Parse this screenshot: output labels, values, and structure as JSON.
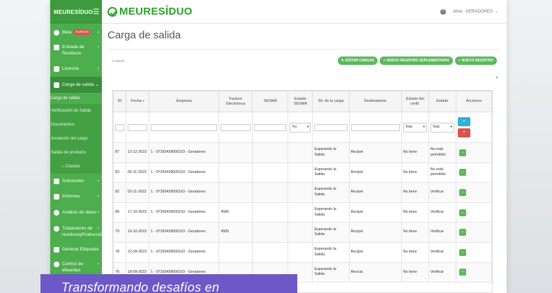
{
  "sidebar": {
    "brand": "MEURESÍDUO",
    "items": [
      {
        "label": "Beta",
        "badge": "NUEVOS"
      },
      {
        "label": "Entrada de Residuos"
      },
      {
        "label": "Licencia"
      },
      {
        "label": "Carga de salida"
      },
      {
        "label": "Solicitudes"
      },
      {
        "label": "Informes"
      },
      {
        "label": "Análisis de datos"
      },
      {
        "label": "Tratamiento de residuosyProducción"
      },
      {
        "label": "Generar Etiquetas"
      },
      {
        "label": "Control de efluentes"
      }
    ],
    "submenu": [
      "Carga de salida",
      "Verificación de Salida",
      "Documentos",
      "Anulación del cargo",
      "Salida de producto",
      "Checkis"
    ]
  },
  "topbar": {
    "logo": "MEURESÍDUO",
    "user": "Aline - GERADORES"
  },
  "page": {
    "title": "Carga de salida",
    "listado": "Listado"
  },
  "buttons": {
    "edit": "EDITAR CARGAS",
    "new_supplementary": "NUEVO REGISTRO SUPLEMENTARIO",
    "new_record": "NUEVO REGISTRO"
  },
  "table": {
    "headers": [
      "ID",
      "Fecha",
      "Empresa",
      "Facture Electrónica",
      "SESMA",
      "Estado SESMA",
      "Sit. de la carga",
      "Destinatarios",
      "Estado del certif.",
      "Estado",
      "Acciones"
    ],
    "filters": {
      "sesma_status": "Toi",
      "cert": "Todc",
      "estado": "Todc"
    },
    "rows": [
      {
        "id": "87",
        "fecha": "12-12-2023",
        "empresa": "1 - 97393439000163 - Geradores",
        "factura": "",
        "sit": "Esperando la Salida",
        "dest": "Recipel",
        "cert": "No tiene",
        "estado": "No está permitido"
      },
      {
        "id": "83",
        "fecha": "06-11-2023",
        "empresa": "1 - 97393439000163 - Geradores",
        "factura": "",
        "sit": "Esperando la Salida",
        "dest": "Recipel",
        "cert": "No tiene",
        "estado": "No está permitido"
      },
      {
        "id": "82",
        "fecha": "03-11-2023",
        "empresa": "1 - 97393439000163 - Geradores",
        "factura": "",
        "sit": "Esperando la Salida",
        "dest": "Recipel",
        "cert": "No tiene",
        "estado": "Verificar"
      },
      {
        "id": "80",
        "fecha": "17-10-2023",
        "empresa": "1 - 97393439000163 - Geradores",
        "factura": "4586",
        "sit": "Esperando la Salida",
        "dest": "Recipel",
        "cert": "No tiene",
        "estado": "Verificar"
      },
      {
        "id": "79",
        "fecha": "16-10-2023",
        "empresa": "1 - 97393439000163 - Geradores",
        "factura": "4585",
        "sit": "Esperando la Salida",
        "dest": "Recipel",
        "cert": "No tiene",
        "estado": "Verificar"
      },
      {
        "id": "78",
        "fecha": "22-09-2023",
        "empresa": "1 - 97393439000163 - Geradores",
        "factura": "",
        "sit": "Esperando la Salida",
        "dest": "Recipel",
        "cert": "No tiene",
        "estado": "Verificar"
      },
      {
        "id": "76",
        "fecha": "18-09-2023",
        "empresa": "1 - 97393439000163 - Geradores",
        "factura": "",
        "sit": "Esperando la Salida",
        "dest": "Recicla",
        "cert": "No tiene",
        "estado": "Verificar"
      }
    ]
  },
  "overlay_caption": "Transformando desafíos en",
  "colors": {
    "brand_green": "#4cae4c",
    "caption_purple": "#6c58c7",
    "danger": "#d9534f",
    "info": "#31b0d5"
  }
}
